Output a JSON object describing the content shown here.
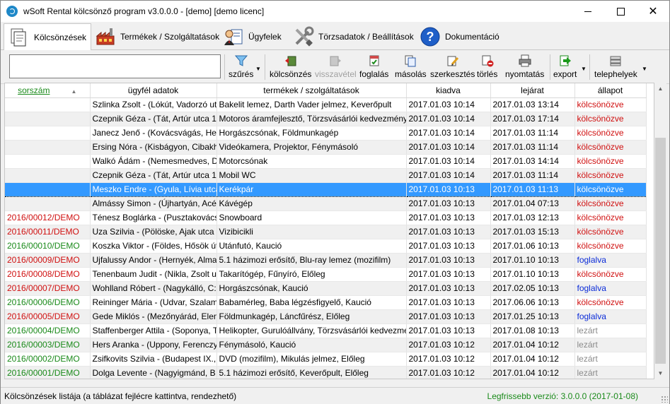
{
  "window": {
    "title": "wSoft Rental kölcsönző program v3.0.0.0 - [demo] [demo licenc]"
  },
  "tabs": [
    {
      "label": "Kölcsönzések",
      "icon": "documents-icon",
      "active": true
    },
    {
      "label": "Termékek / Szolgáltatások",
      "icon": "factory-icon",
      "active": false
    },
    {
      "label": "Ügyfelek",
      "icon": "person-card-icon",
      "active": false
    },
    {
      "label": "Törzsadatok / Beállítások",
      "icon": "tools-icon",
      "active": false
    },
    {
      "label": "Dokumentáció",
      "icon": "help-icon",
      "active": false
    }
  ],
  "toolbar": {
    "search_value": "",
    "filter": "szűrés",
    "rent": "kölcsönzés",
    "return": "visszavétel",
    "book": "foglalás",
    "copy": "másolás",
    "edit": "szerkesztés",
    "delete": "törlés",
    "print": "nyomtatás",
    "export": "export",
    "sites": "telephelyek"
  },
  "table": {
    "headers": [
      "sorszám",
      "ügyfél adatok",
      "termékek / szolgáltatások",
      "kiadva",
      "lejárat",
      "állapot"
    ],
    "rows": [
      {
        "id": "",
        "customer": "Szlinka Zsolt - (Lókút, Vadorzó ut",
        "products": "Bakelit lemez, Darth Vader jelmez, Keverőpult",
        "issued": "2017.01.03  10:14",
        "due": "2017.01.03  13:14",
        "status": "kölcsönözve",
        "status_color": "red",
        "id_color": "red"
      },
      {
        "id": "",
        "customer": "Czepnik Géza - (Tát, Artúr utca 14",
        "products": "Motoros áramfejlesztő, Törzsvásárlói kedvezmény",
        "issued": "2017.01.03  10:14",
        "due": "2017.01.03  17:14",
        "status": "kölcsönözve",
        "status_color": "red",
        "id_color": "red"
      },
      {
        "id": "",
        "customer": "Janecz Jenő - (Kovácsvágás, Hegy",
        "products": "Horgászcsónak, Földmunkagép",
        "issued": "2017.01.03  10:14",
        "due": "2017.01.03  11:14",
        "status": "kölcsönözve",
        "status_color": "red",
        "id_color": "red"
      },
      {
        "id": "",
        "customer": "Ersing Nóra - (Kisbágyon, Cibakh",
        "products": "Videókamera, Projektor, Fénymásoló",
        "issued": "2017.01.03  10:14",
        "due": "2017.01.03  11:14",
        "status": "kölcsönözve",
        "status_color": "red",
        "id_color": "red"
      },
      {
        "id": "",
        "customer": "Walkó Ádám - (Nemesmedves, D",
        "products": "Motorcsónak",
        "issued": "2017.01.03  10:14",
        "due": "2017.01.03  14:14",
        "status": "kölcsönözve",
        "status_color": "red",
        "id_color": "red"
      },
      {
        "id": "",
        "customer": "Czepnik Géza - (Tát, Artúr utca 14",
        "products": "Mobil WC",
        "issued": "2017.01.03  10:14",
        "due": "2017.01.03  11:14",
        "status": "kölcsönözve",
        "status_color": "red",
        "id_color": "red"
      },
      {
        "id": "",
        "customer": "Meszko Endre - (Gyula, Lívia utca",
        "products": "Kerékpár",
        "issued": "2017.01.03  10:13",
        "due": "2017.01.03  11:13",
        "status": "kölcsönözve",
        "status_color": "red",
        "id_color": "red",
        "selected": true
      },
      {
        "id": "",
        "customer": "Almássy Simon - (Újhartyán, Acé",
        "products": "Kávégép",
        "issued": "2017.01.03  10:13",
        "due": "2017.01.04  07:13",
        "status": "kölcsönözve",
        "status_color": "red",
        "id_color": "red"
      },
      {
        "id": "2016/00012/DEMO",
        "customer": "Ténesz Boglárka - (Pusztakovácsi,",
        "products": "Snowboard",
        "issued": "2017.01.03  10:13",
        "due": "2017.01.03  12:13",
        "status": "kölcsönözve",
        "status_color": "red",
        "id_color": "red"
      },
      {
        "id": "2016/00011/DEMO",
        "customer": "Uza Szilvia - (Pölöske, Ajak utca 1",
        "products": "Vizibicikli",
        "issued": "2017.01.03  10:13",
        "due": "2017.01.03  15:13",
        "status": "kölcsönözve",
        "status_color": "red",
        "id_color": "red"
      },
      {
        "id": "2016/00010/DEMO",
        "customer": "Koszka Viktor - (Földes, Hősök út",
        "products": "Utánfutó, Kaució",
        "issued": "2017.01.03  10:13",
        "due": "2017.01.06  10:13",
        "status": "kölcsönözve",
        "status_color": "red",
        "id_color": "green"
      },
      {
        "id": "2016/00009/DEMO",
        "customer": "Ujfalussy Andor - (Hernyék, Alma",
        "products": "5.1 házimozi erősítő, Blu-ray lemez (mozifilm)",
        "issued": "2017.01.03  10:13",
        "due": "2017.01.10  10:13",
        "status": "foglalva",
        "status_color": "blue",
        "id_color": "red"
      },
      {
        "id": "2016/00008/DEMO",
        "customer": "Tenenbaum Judit - (Nikla, Zsolt u",
        "products": "Takarítógép, Fűnyíró, Előleg",
        "issued": "2017.01.03  10:13",
        "due": "2017.01.10  10:13",
        "status": "kölcsönözve",
        "status_color": "red",
        "id_color": "red"
      },
      {
        "id": "2016/00007/DEMO",
        "customer": "Wohlland Róbert - (Nagykálló, C:",
        "products": "Horgászcsónak, Kaució",
        "issued": "2017.01.03  10:13",
        "due": "2017.02.05  10:13",
        "status": "foglalva",
        "status_color": "blue",
        "id_color": "red"
      },
      {
        "id": "2016/00006/DEMO",
        "customer": "Reininger Mária - (Udvar, Szalam",
        "products": "Babamérleg, Baba légzésfigyelő, Kaució",
        "issued": "2017.01.03  10:13",
        "due": "2017.06.06  10:13",
        "status": "kölcsönözve",
        "status_color": "red",
        "id_color": "green"
      },
      {
        "id": "2016/00005/DEMO",
        "customer": "Gede Miklós - (Mezőnyárád, Elen",
        "products": "Földmunkagép, Láncfűrész, Előleg",
        "issued": "2017.01.03  10:13",
        "due": "2017.01.25  10:13",
        "status": "foglalva",
        "status_color": "blue",
        "id_color": "red"
      },
      {
        "id": "2016/00004/DEMO",
        "customer": "Staffenberger Attila - (Soponya, T",
        "products": "Helikopter, Gurulóállvány, Törzsvásárlói kedvezmé",
        "issued": "2017.01.03  10:13",
        "due": "2017.01.08  10:13",
        "status": "lezárt",
        "status_color": "gray",
        "id_color": "green"
      },
      {
        "id": "2016/00003/DEMO",
        "customer": "Hers Aranka - (Uppony, Ferenczy",
        "products": "Fénymásoló, Kaució",
        "issued": "2017.01.03  10:12",
        "due": "2017.01.04  10:12",
        "status": "lezárt",
        "status_color": "gray",
        "id_color": "green"
      },
      {
        "id": "2016/00002/DEMO",
        "customer": "Zsifkovits Szilvia - (Budapest IX.,",
        "products": "DVD (mozifilm), Mikulás jelmez, Előleg",
        "issued": "2017.01.03  10:12",
        "due": "2017.01.04  10:12",
        "status": "lezárt",
        "status_color": "gray",
        "id_color": "green"
      },
      {
        "id": "2016/00001/DEMO",
        "customer": "Dolga Levente - (Nagyigmánd, B",
        "products": "5.1 házimozi erősítő, Keverőpult, Előleg",
        "issued": "2017.01.03  10:12",
        "due": "2017.01.04  10:12",
        "status": "lezárt",
        "status_color": "gray",
        "id_color": "green"
      }
    ]
  },
  "statusbar": {
    "left": "Kölcsönzések listája (a táblázat fejlécre kattintva, rendezhető)",
    "right": "Legfrissebb verzió: 3.0.0.0 (2017-01-08)"
  }
}
